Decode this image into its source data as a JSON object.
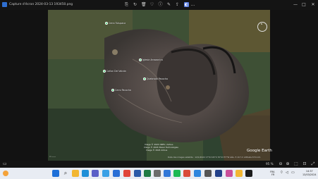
{
  "window": {
    "title": "Capture d'écran 2024-03-13 193450.png",
    "icons": [
      "save-icon",
      "rotate-icon",
      "delete-icon",
      "favorite-icon",
      "info-icon",
      "edit-icon",
      "share-icon",
      "more-icon"
    ],
    "controls": {
      "minimize": "—",
      "maximize": "□",
      "close": "✕"
    }
  },
  "map": {
    "places": [
      {
        "name": "Cerro Tutupaca"
      },
      {
        "name": "Cañon Del Volcán"
      },
      {
        "name": "Iglesia Amazonica"
      },
      {
        "name": "Quebrada Pacocha"
      },
      {
        "name": "Cerro Pacocha"
      }
    ],
    "credits": [
      "Image © 2024 CNES / Airbus",
      "Image © 2024 Maxar Technologies",
      "Image © 2024 Airbus"
    ],
    "bottom_info": "Date des images satellite : 12/1/2022    17°01'24\"S 70°21'37\"W  élév. 5 117 m  Altitude 8 51 km",
    "logo": "Google Earth"
  },
  "statusbar": {
    "zoom": "95 %"
  },
  "taskbar": {
    "lang": "FRA",
    "region": "FR",
    "time": "14:37",
    "date": "13/03/2024",
    "apps": [
      {
        "name": "start",
        "color": "#1d6fd8"
      },
      {
        "name": "file-explorer",
        "color": "#f2b632"
      },
      {
        "name": "edge",
        "color": "#1f8fd8"
      },
      {
        "name": "teams",
        "color": "#5b5fc7"
      },
      {
        "name": "photos",
        "color": "#3aa0e6"
      },
      {
        "name": "mail",
        "color": "#2a6fd6"
      },
      {
        "name": "chrome",
        "color": "#e0443a"
      },
      {
        "name": "word",
        "color": "#2b5aa8"
      },
      {
        "name": "excel",
        "color": "#1f7a44"
      },
      {
        "name": "settings",
        "color": "#6b6b6b"
      },
      {
        "name": "store",
        "color": "#3177d8"
      },
      {
        "name": "spotify",
        "color": "#1db954"
      },
      {
        "name": "app-red",
        "color": "#d94a3a"
      },
      {
        "name": "app-blue",
        "color": "#2e86de"
      },
      {
        "name": "app-gray",
        "color": "#555555"
      },
      {
        "name": "app-navy",
        "color": "#22408a"
      }
    ]
  }
}
